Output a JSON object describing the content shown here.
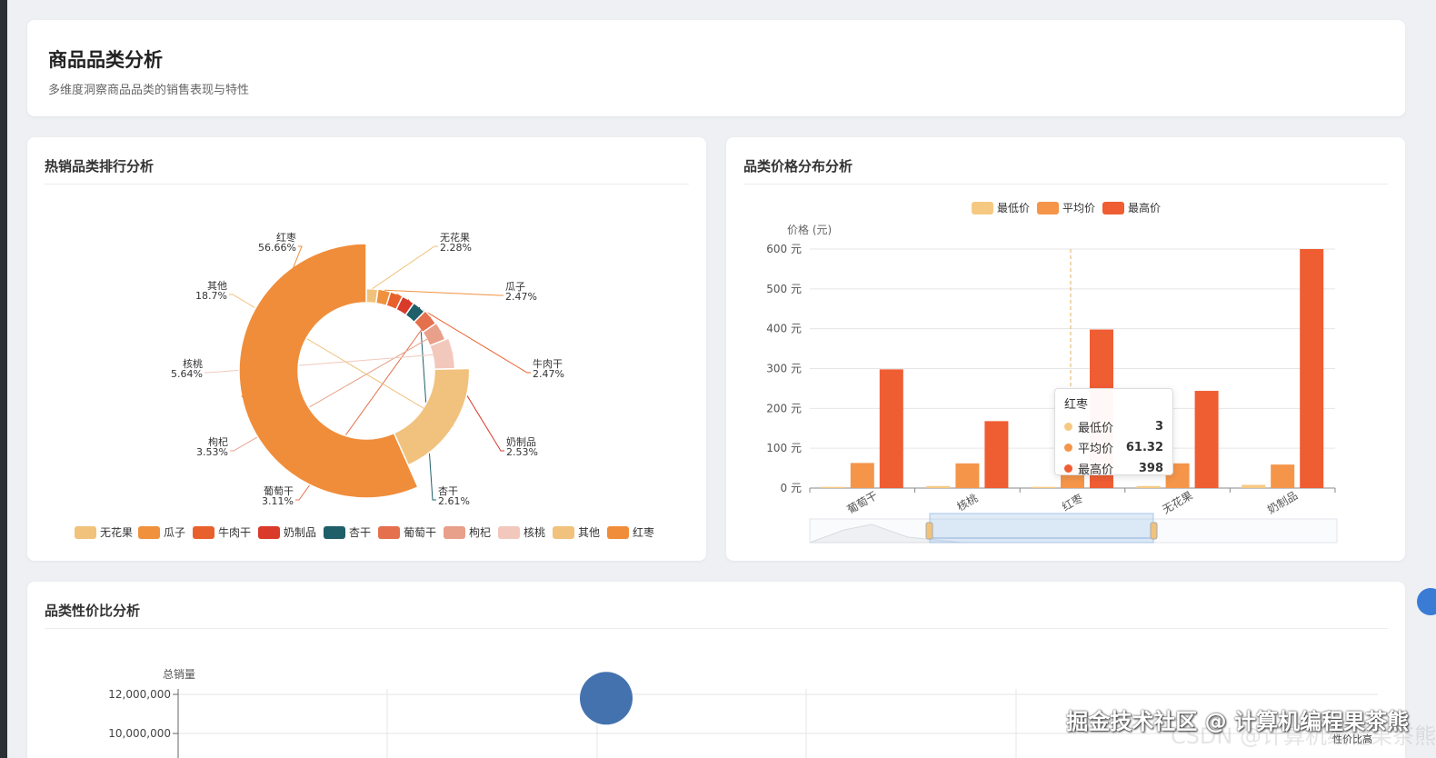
{
  "page": {
    "title": "商品品类分析",
    "subtitle": "多维度洞察商品品类的销售表现与特性"
  },
  "pie_card": {
    "title": "热销品类排行分析"
  },
  "bar_card": {
    "title": "品类价格分布分析",
    "tooltip": {
      "title": "红枣",
      "rows": [
        {
          "label": "最低价",
          "value": "3"
        },
        {
          "label": "平均价",
          "value": "61.32"
        },
        {
          "label": "最高价",
          "value": "398"
        }
      ]
    }
  },
  "scatter_card": {
    "title": "品类性价比分析"
  },
  "watermark": "掘金技术社区 @ 计算机编程果茶熊",
  "watermark_faint": "CSDN @计算机编程果茶熊",
  "chart_data": [
    {
      "type": "pie",
      "categories": [
        "无花果",
        "瓜子",
        "牛肉干",
        "奶制品",
        "杏干",
        "葡萄干",
        "枸杞",
        "核桃",
        "其他",
        "红枣"
      ],
      "values": [
        2.28,
        2.47,
        2.47,
        2.53,
        2.61,
        3.11,
        3.53,
        5.64,
        18.7,
        56.66
      ],
      "labels": [
        "2.28%",
        "2.47%",
        "2.47%",
        "2.53%",
        "2.61%",
        "3.11%",
        "3.53%",
        "5.64%",
        "18.7%",
        "56.66%"
      ],
      "colors": [
        "#f0c27b",
        "#f0913e",
        "#e8612c",
        "#d93a2a",
        "#1f5f6a",
        "#e5704d",
        "#e8a08a",
        "#f2c8bc",
        "#f1c27d",
        "#f08d3a"
      ],
      "legend_position": "bottom",
      "rose": true
    },
    {
      "type": "bar",
      "categories": [
        "葡萄干",
        "核桃",
        "红枣",
        "无花果",
        "奶制品"
      ],
      "series": [
        {
          "name": "最低价",
          "values": [
            3,
            5,
            3,
            5,
            8
          ],
          "color": "#f6c983"
        },
        {
          "name": "平均价",
          "values": [
            63,
            62,
            61.32,
            62,
            59
          ],
          "color": "#f4954a"
        },
        {
          "name": "最高价",
          "values": [
            298,
            168,
            398,
            244,
            600
          ],
          "color": "#ef5d33"
        }
      ],
      "ylabel": "价格 (元)",
      "yticks": [
        "0 元",
        "100 元",
        "200 元",
        "300 元",
        "400 元",
        "500 元",
        "600 元"
      ],
      "ylim": [
        0,
        600
      ],
      "legend_position": "top",
      "grid": true
    },
    {
      "type": "scatter",
      "ylabel": "总销量",
      "xlabel": "性价比高",
      "yticks": [
        "12,000,000",
        "10,000,000"
      ],
      "points": [
        {
          "y": 11800000,
          "color": "#4472ae"
        }
      ]
    }
  ]
}
